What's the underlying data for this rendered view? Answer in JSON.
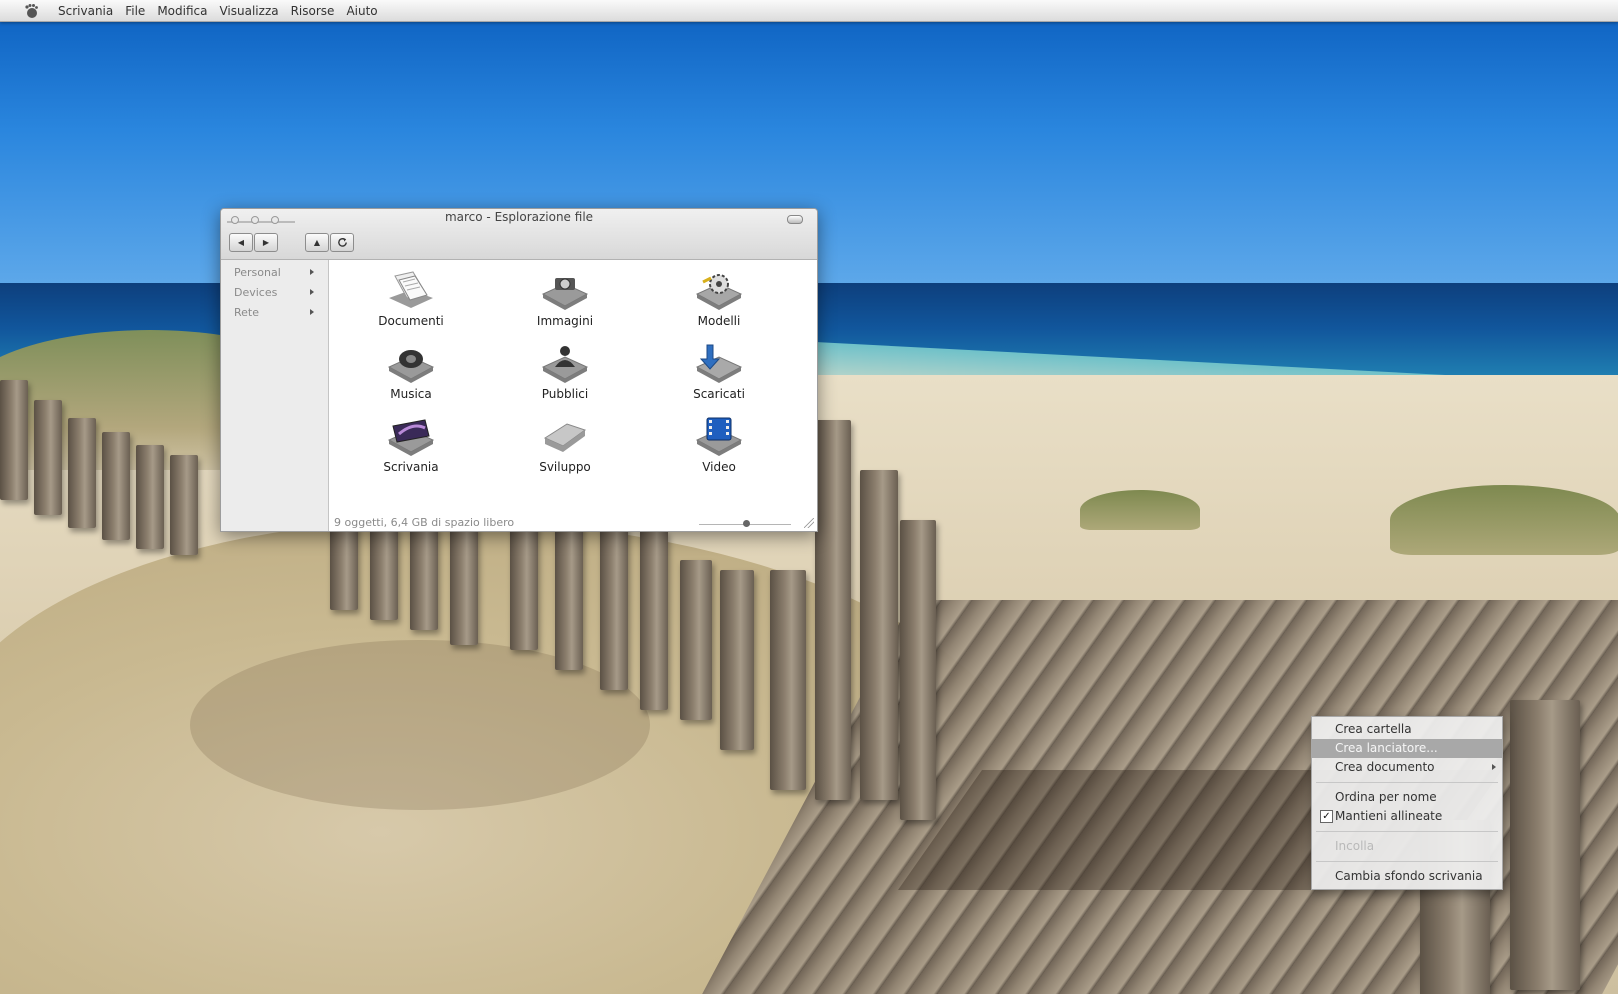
{
  "top_panel": {
    "menus": [
      "Scrivania",
      "File",
      "Modifica",
      "Visualizza",
      "Risorse",
      "Aiuto"
    ]
  },
  "file_manager": {
    "title": "marco - Esplorazione file",
    "sidebar": [
      "Personal",
      "Devices",
      "Rete"
    ],
    "items": [
      {
        "label": "Documenti",
        "icon": "documents-folder-icon"
      },
      {
        "label": "Immagini",
        "icon": "pictures-folder-icon"
      },
      {
        "label": "Modelli",
        "icon": "templates-folder-icon"
      },
      {
        "label": "Musica",
        "icon": "music-folder-icon"
      },
      {
        "label": "Pubblici",
        "icon": "public-folder-icon"
      },
      {
        "label": "Scaricati",
        "icon": "downloads-folder-icon"
      },
      {
        "label": "Scrivania",
        "icon": "desktop-folder-icon"
      },
      {
        "label": "Sviluppo",
        "icon": "folder-icon"
      },
      {
        "label": "Video",
        "icon": "videos-folder-icon"
      }
    ],
    "status": "9 oggetti, 6,4 GB di spazio libero"
  },
  "context_menu": {
    "items": [
      {
        "label": "Crea cartella",
        "state": "normal"
      },
      {
        "label": "Crea lanciatore...",
        "state": "selected"
      },
      {
        "label": "Crea documento",
        "state": "submenu"
      },
      {
        "label": "Ordina per nome",
        "state": "normal"
      },
      {
        "label": "Mantieni allineate",
        "state": "checked"
      },
      {
        "label": "Incolla",
        "state": "disabled"
      },
      {
        "label": "Cambia sfondo scrivania",
        "state": "normal"
      }
    ]
  }
}
